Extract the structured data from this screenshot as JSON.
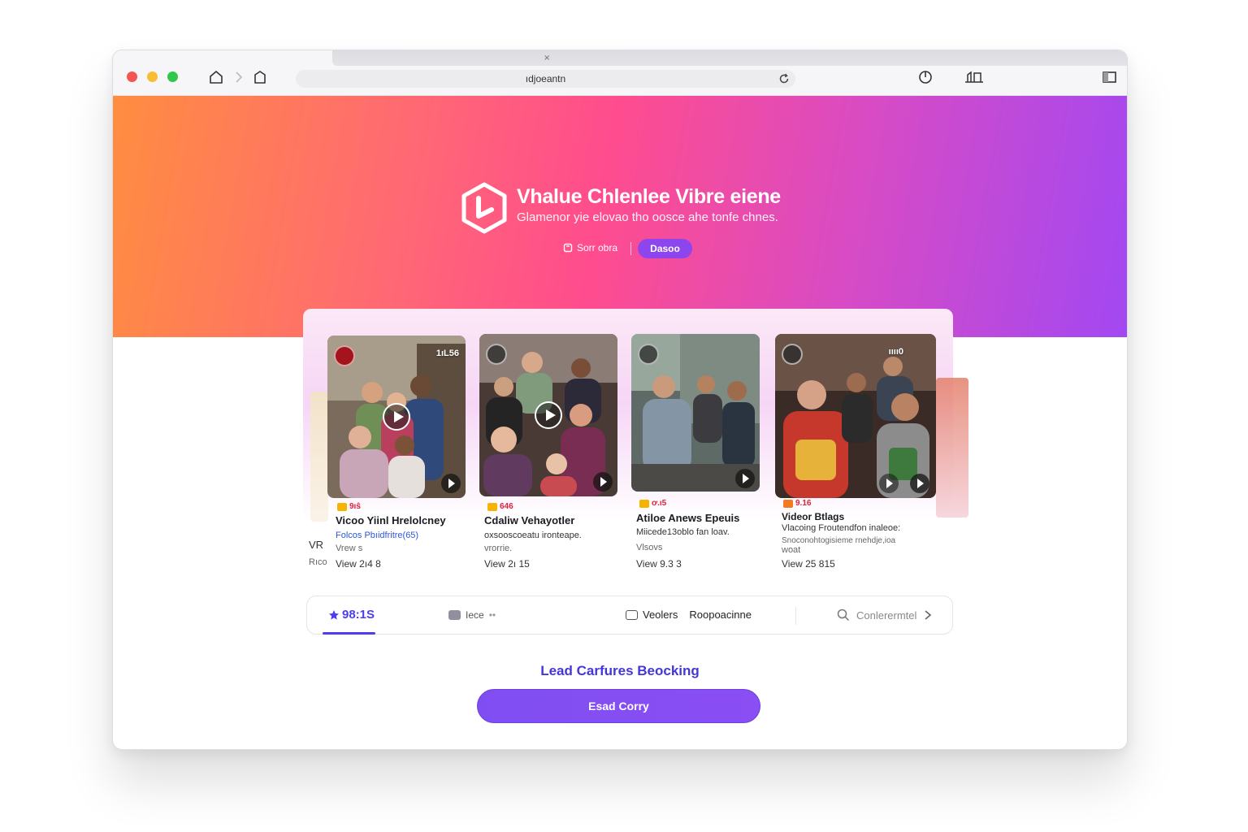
{
  "browser": {
    "address": "ıdjoeantn",
    "icons": [
      "home-icon",
      "chevron-right-icon",
      "tab-icon",
      "reload-icon",
      "shield-icon",
      "share-icon",
      "sidebar-icon"
    ],
    "tab_close": "×"
  },
  "hero": {
    "title": "Vhalue Chlenlee Vibre eiene",
    "subtitle": "Glamenor yie elovao tho oosce ahe tonfe chnes.",
    "link_label": "Sorr obra",
    "pill_label": "Dasoo",
    "gradient": [
      "#ff8d40",
      "#ff4c8e",
      "#a248f2"
    ]
  },
  "peek_left": {
    "label1": "VR",
    "label2": "Rıco"
  },
  "cards": [
    {
      "count": "1ıL56",
      "stat": "9ıŝ",
      "title": "Vicoo Yiinl Hrelolcney",
      "desc": "Folcos Pbıidfritre(65)",
      "meta": "Vrew s",
      "views": "View 2ı4 8"
    },
    {
      "count": "",
      "stat": "646",
      "title": "Cdaliw Vehayotler",
      "desc": "oxsooscoeatu ironteape.",
      "meta": "vrorrie.",
      "views": "View 2ı 15"
    },
    {
      "count": "",
      "stat": "ơ.ı5",
      "title": "Atiloe Anews Epeuis",
      "desc": "Miicede13oblo fan loav.",
      "meta": "Vlsovs",
      "views": "View 9.3 3"
    },
    {
      "count": "ıııı0",
      "stat": "9.16",
      "title": "Videor Btlags",
      "desc": "Vlacoing Froutendfon inaleoe:",
      "desc2": "Snoconohtogisieme rnehdje,ioa",
      "meta": "woat",
      "views": "View 25 815"
    }
  ],
  "tabs": {
    "active": "98:1S",
    "tab2": "Iece",
    "tab2_dots": "••",
    "tab3_a": "Veolers",
    "tab3_b": "Roopoacinne",
    "search": "Conlerermtel"
  },
  "cta": {
    "label": "Lead Carfures Beocking",
    "button": "Esad Corry",
    "color": "#8a4ef3"
  }
}
